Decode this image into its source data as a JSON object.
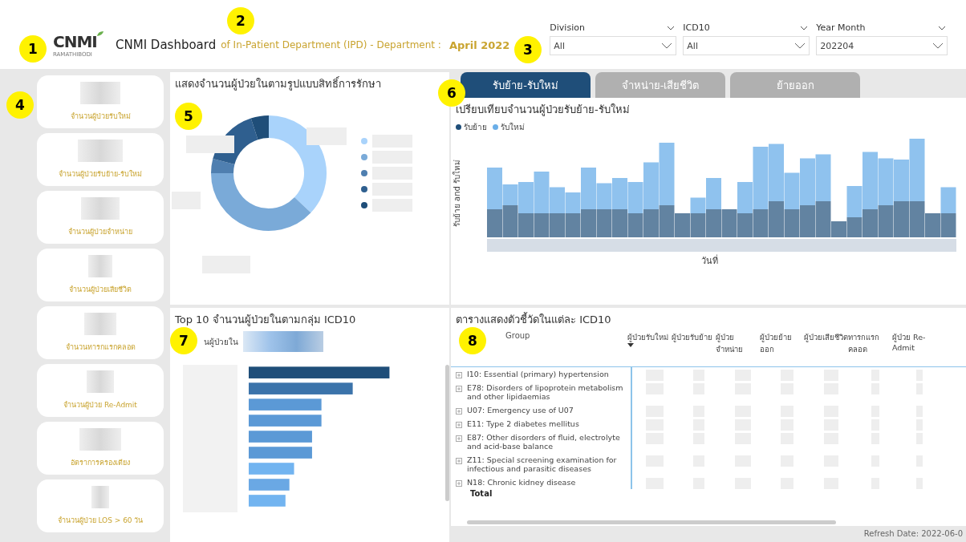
{
  "callouts": [
    "1",
    "2",
    "3",
    "4",
    "5",
    "6",
    "7",
    "8"
  ],
  "header": {
    "logo": {
      "text": "CNMI",
      "subtext": "RAMATHIBODI"
    },
    "title": "CNMI Dashboard",
    "subtitle": "of In-Patient Department (IPD) - Department :",
    "period": "April 2022"
  },
  "filters": [
    {
      "label": "Division",
      "value": "All"
    },
    {
      "label": "ICD10",
      "value": "All"
    },
    {
      "label": "Year Month",
      "value": "202204"
    }
  ],
  "kpi_cards": [
    "จำนวนผู้ป่วยรับใหม่",
    "จำนวนผู้ป่วยรับย้าย-รับใหม่",
    "จำนวนผู้ป่วยจำหน่าย",
    "จำนวนผู้ป่วยเสียชีวิต",
    "จำนวนทารกแรกคลอด",
    "จำนวนผู้ป่วย Re-Admit",
    "อัตราการครองเตียง",
    "จำนวนผู้ป่วย LOS > 60 วัน"
  ],
  "donut_panel": {
    "title": "แสดงจำนวนผู้ป่วยในตามรูปแบบสิทธิ์การรักษา",
    "legend": [
      {
        "color": "#a9d3fb"
      },
      {
        "color": "#7aaad8"
      },
      {
        "color": "#4f7fb0"
      },
      {
        "color": "#2f5f8f"
      },
      {
        "color": "#1f4e79"
      }
    ]
  },
  "tabs": [
    {
      "label": "รับย้าย-รับใหม่",
      "selected": true
    },
    {
      "label": "จำหน่าย-เสียชีวิต",
      "selected": false
    },
    {
      "label": "ย้ายออก",
      "selected": false
    }
  ],
  "column_chart": {
    "title": "เปรียบเทียบจำนวนผู้ป่วยรับย้าย-รับใหม่",
    "legend": [
      {
        "label": "รับย้าย",
        "color": "#1f4e79"
      },
      {
        "label": "รับใหม่",
        "color": "#6aaee8"
      }
    ],
    "ylabel": "รับย้าย and รับใหม่",
    "xlabel": "วันที่"
  },
  "bar_panel": {
    "title": "Top 10 จำนวนผู้ป่วยในตามกลุ่ม ICD10",
    "subtitle": "นผู้ป่วยใน"
  },
  "table": {
    "title": "ตารางแสดงตัวชี้วัดในแต่ละ ICD10",
    "group_header": "Group",
    "columns": [
      {
        "label": "ผู้ป่วยรับใหม่",
        "sorted": true
      },
      {
        "label": "ผู้ป่วยรับย้าย",
        "sorted": false
      },
      {
        "label": "ผู้ป่วยจำหน่าย",
        "sorted": false
      },
      {
        "label": "ผู้ป่วยย้ายออก",
        "sorted": false
      },
      {
        "label": "ผู้ป่วยเสียชีวิต",
        "sorted": false
      },
      {
        "label": "ทารกแรกคลอด",
        "sorted": false
      },
      {
        "label": "ผู้ป่วย Re-Admit",
        "sorted": false
      }
    ],
    "rows": [
      "I10: Essential (primary) hypertension",
      "E78: Disorders of lipoprotein metabolism and other lipidaemias",
      "U07: Emergency use of U07",
      "E11: Type 2 diabetes mellitus",
      "E87: Other disorders of fluid, electrolyte and acid-base balance",
      "Z11: Special screening examination for infectious and parasitic diseases",
      "N18: Chronic kidney disease"
    ],
    "total": "Total"
  },
  "refresh": "Refresh Date: 2022-06-0"
}
